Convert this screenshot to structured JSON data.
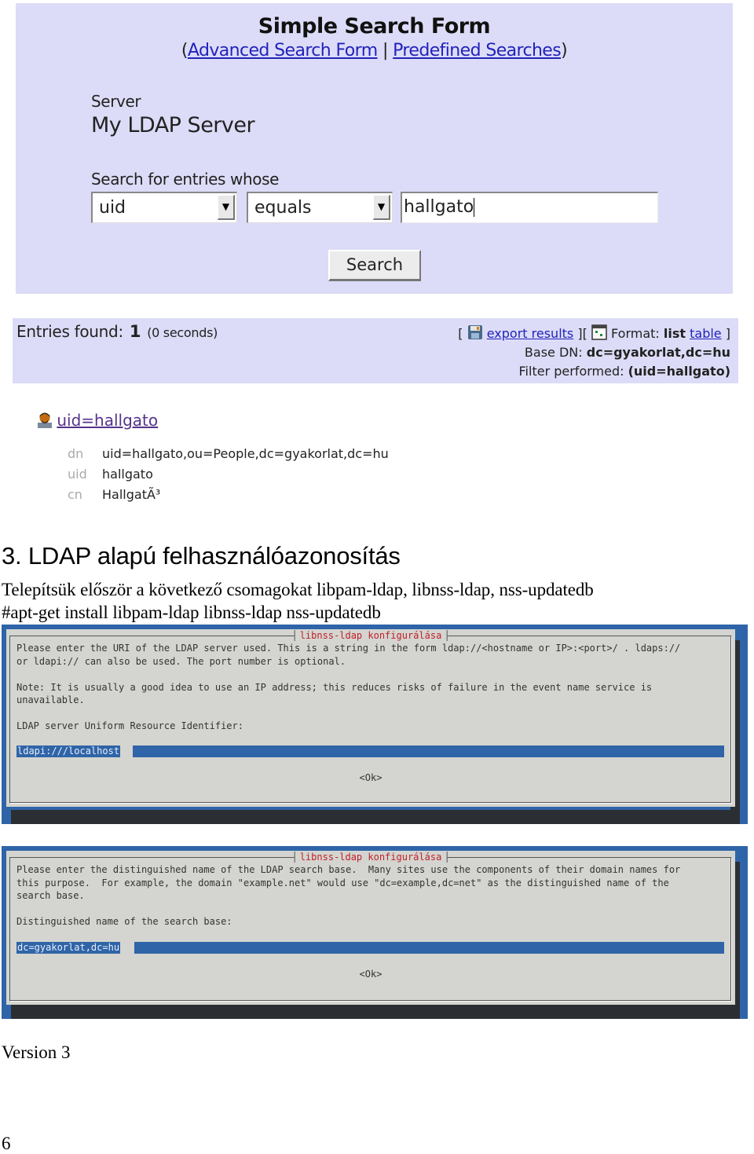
{
  "search_form": {
    "title": "Simple Search Form",
    "links_open": "(",
    "advanced_link": "Advanced Search Form",
    "separator": " | ",
    "predefined_link": "Predefined Searches",
    "links_close": ")",
    "server_label": "Server",
    "server_name": "My LDAP Server",
    "search_label": "Search for entries whose",
    "attribute_select": "uid",
    "operator_select": "equals",
    "query_value": "hallgato",
    "search_button": "Search",
    "colors": {
      "panel_bg": "#dcdcf8",
      "link": "#2222bb"
    }
  },
  "results": {
    "entries_label": "Entries found:",
    "count": "1",
    "time": "(0 seconds)",
    "bracket_open": "[",
    "export_link": "export results",
    "mid_bracket": "][",
    "format_label": "Format:",
    "format_current": "list",
    "format_alt_link": "table",
    "bracket_close": "]",
    "base_dn_label": "Base DN:",
    "base_dn_value": "dc=gyakorlat,dc=hu",
    "filter_label": "Filter performed:",
    "filter_value": "(uid=hallgato)",
    "icons": {
      "export": "floppy-disk-icon",
      "format": "table-format-icon"
    }
  },
  "entry": {
    "icon": "user-icon",
    "title_link": "uid=hallgato",
    "attributes": [
      {
        "key": "dn",
        "value": "uid=hallgato,ou=People,dc=gyakorlat,dc=hu"
      },
      {
        "key": "uid",
        "value": "hallgato"
      },
      {
        "key": "cn",
        "value": "HallgatÃ³"
      }
    ]
  },
  "document": {
    "heading": "3. LDAP alapú felhasználóazonosítás",
    "paragraph1": "Telepítsük először a következő csomagokat libpam-ldap, libnss-ldap, nss-updatedb",
    "paragraph2": "#apt-get install libpam-ldap libnss-ldap nss-updatedb",
    "version": "Version 3",
    "page_number": "6"
  },
  "dialog1": {
    "title": "libnss-ldap konfigurálása",
    "text": "Please enter the URI of the LDAP server used. This is a string in the form ldap://<hostname or IP>:<port>/ . ldaps://\nor ldapi:// can also be used. The port number is optional.\n\nNote: It is usually a good idea to use an IP address; this reduces risks of failure in the event name service is\nunavailable.\n\nLDAP server Uniform Resource Identifier:",
    "input_value": "ldapi:///localhost",
    "ok_button": "<Ok>",
    "colors": {
      "background": "#2f64a8",
      "dialog": "#d4d5d0",
      "title": "#c0202a"
    }
  },
  "dialog2": {
    "title": "libnss-ldap konfigurálása",
    "text": "Please enter the distinguished name of the LDAP search base.  Many sites use the components of their domain names for\nthis purpose.  For example, the domain \"example.net\" would use \"dc=example,dc=net\" as the distinguished name of the\nsearch base.\n\nDistinguished name of the search base:",
    "input_value": "dc=gyakorlat,dc=hu",
    "ok_button": "<Ok>"
  }
}
